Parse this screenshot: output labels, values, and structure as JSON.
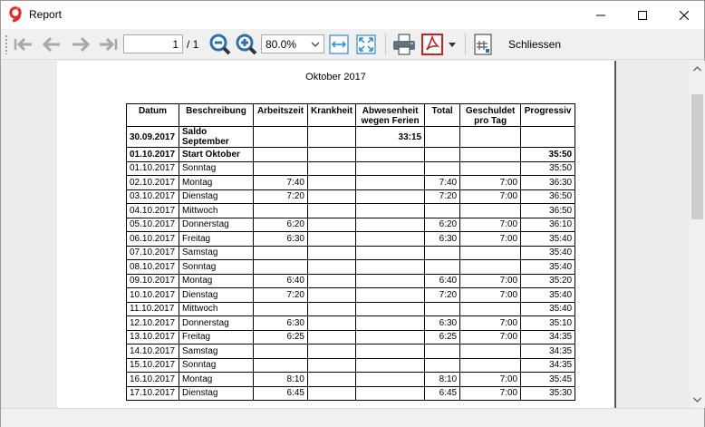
{
  "window": {
    "title": "Report"
  },
  "toolbar": {
    "page_value": "1",
    "page_total": "/ 1",
    "zoom_value": "80.0%",
    "close_label": "Schliessen"
  },
  "report": {
    "title": "Oktober 2017",
    "headers": [
      "Datum",
      "Beschreibung",
      "Arbeitszeit",
      "Krankheit",
      "Abwesenheit wegen Ferien",
      "Total",
      "Geschuldet pro Tag",
      "Progressiv"
    ],
    "rows": [
      [
        "30.09.2017",
        "Saldo September",
        "",
        "",
        "33:15",
        "",
        "",
        ""
      ],
      [
        "01.10.2017",
        "Start Oktober",
        "",
        "",
        "",
        "",
        "",
        "35:50"
      ],
      [
        "01.10.2017",
        "Sonntag",
        "",
        "",
        "",
        "",
        "",
        "35:50"
      ],
      [
        "02.10.2017",
        "Montag",
        "7:40",
        "",
        "",
        "7:40",
        "7:00",
        "36:30"
      ],
      [
        "03.10.2017",
        "Dienstag",
        "7:20",
        "",
        "",
        "7:20",
        "7:00",
        "36:50"
      ],
      [
        "04.10.2017",
        "Mittwoch",
        "",
        "",
        "",
        "",
        "",
        "36:50"
      ],
      [
        "05.10.2017",
        "Donnerstag",
        "6:20",
        "",
        "",
        "6:20",
        "7:00",
        "36:10"
      ],
      [
        "06.10.2017",
        "Freitag",
        "6:30",
        "",
        "",
        "6:30",
        "7:00",
        "35:40"
      ],
      [
        "07.10.2017",
        "Samstag",
        "",
        "",
        "",
        "",
        "",
        "35:40"
      ],
      [
        "08.10.2017",
        "Sonntag",
        "",
        "",
        "",
        "",
        "",
        "35:40"
      ],
      [
        "09.10.2017",
        "Montag",
        "6:40",
        "",
        "",
        "6:40",
        "7:00",
        "35:20"
      ],
      [
        "10.10.2017",
        "Dienstag",
        "7:20",
        "",
        "",
        "7:20",
        "7:00",
        "35:40"
      ],
      [
        "11.10.2017",
        "Mittwoch",
        "",
        "",
        "",
        "",
        "",
        "35:40"
      ],
      [
        "12.10.2017",
        "Donnerstag",
        "6:30",
        "",
        "",
        "6:30",
        "7:00",
        "35:10"
      ],
      [
        "13.10.2017",
        "Freitag",
        "6:25",
        "",
        "",
        "6:25",
        "7:00",
        "34:35"
      ],
      [
        "14.10.2017",
        "Samstag",
        "",
        "",
        "",
        "",
        "",
        "34:35"
      ],
      [
        "15.10.2017",
        "Sonntag",
        "",
        "",
        "",
        "",
        "",
        "34:35"
      ],
      [
        "16.10.2017",
        "Montag",
        "8:10",
        "",
        "",
        "8:10",
        "7:00",
        "35:45"
      ],
      [
        "17.10.2017",
        "Dienstag",
        "6:45",
        "",
        "",
        "6:45",
        "7:00",
        "35:30"
      ]
    ],
    "bold_rows": [
      0,
      1
    ]
  },
  "icons": [
    "app-logo-icon",
    "first-page-icon",
    "previous-page-icon",
    "next-page-icon",
    "last-page-icon",
    "zoom-out-icon",
    "zoom-in-icon",
    "fit-width-icon",
    "fit-page-icon",
    "print-icon",
    "pdf-export-icon",
    "dropdown-arrow-icon",
    "calculator-icon",
    "minimize-icon",
    "maximize-icon",
    "close-icon"
  ],
  "colors": {
    "zoom_icons": "#2d6fb5",
    "fit_icons": "#2a8ad6",
    "pdf_red": "#cc1f1f",
    "app_logo_red": "#e8262a"
  }
}
